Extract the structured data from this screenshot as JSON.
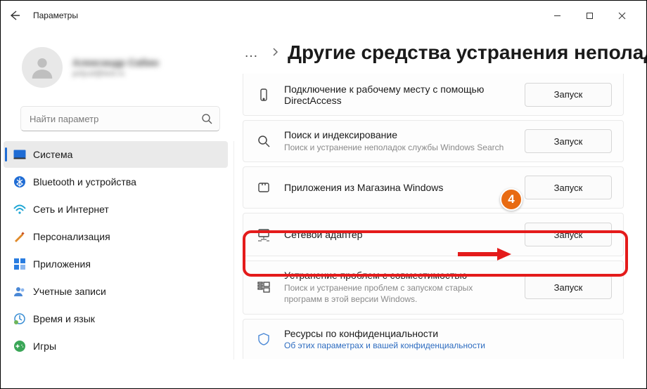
{
  "window": {
    "title": "Параметры",
    "min_label": "Свернуть",
    "max_label": "Развернуть",
    "close_label": "Закрыть"
  },
  "user": {
    "name": "Александр Сабин",
    "email": "polyud@test.ru"
  },
  "search": {
    "placeholder": "Найти параметр"
  },
  "sidebar": {
    "items": [
      {
        "key": "system",
        "label": "Система"
      },
      {
        "key": "bluetooth",
        "label": "Bluetooth и устройства"
      },
      {
        "key": "network",
        "label": "Сеть и Интернет"
      },
      {
        "key": "personalization",
        "label": "Персонализация"
      },
      {
        "key": "apps",
        "label": "Приложения"
      },
      {
        "key": "accounts",
        "label": "Учетные записи"
      },
      {
        "key": "timelang",
        "label": "Время и язык"
      },
      {
        "key": "games",
        "label": "Игры"
      }
    ],
    "active": "system"
  },
  "breadcrumb": {
    "page_title": "Другие средства устранения неполадок"
  },
  "troubleshooters": {
    "run_label": "Запуск",
    "items": [
      {
        "key": "directaccess",
        "title": "Подключение к рабочему месту с помощью DirectAccess",
        "sub": ""
      },
      {
        "key": "search",
        "title": "Поиск и индексирование",
        "sub": "Поиск и устранение неполадок службы Windows Search"
      },
      {
        "key": "store",
        "title": "Приложения из Магазина Windows",
        "sub": ""
      },
      {
        "key": "netadapter",
        "title": "Сетевой адаптер",
        "sub": ""
      },
      {
        "key": "compat",
        "title": "Устранение проблем с совместимостью",
        "sub": "Поиск и устранение проблем с запуском старых программ в этой версии Windows."
      },
      {
        "key": "privacy",
        "title": "Ресурсы по конфиденциальности",
        "link": "Об этих параметрах и вашей конфиденциальности"
      }
    ]
  },
  "annotation": {
    "step": "4"
  }
}
